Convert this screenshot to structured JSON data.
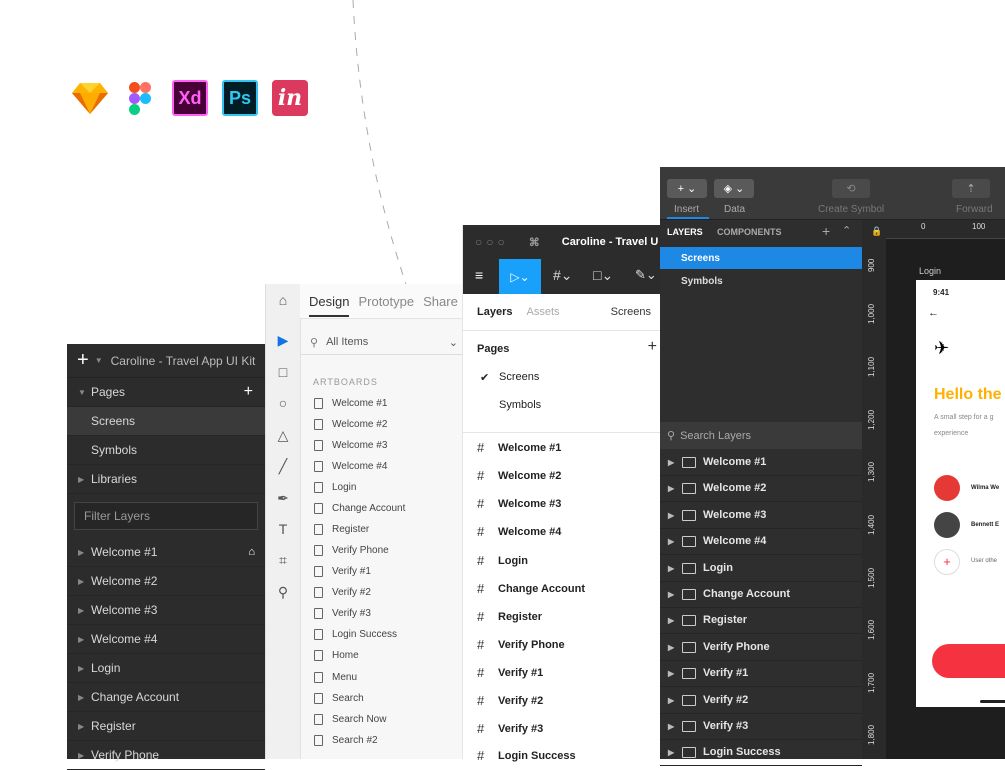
{
  "app_icons": [
    "sketch-icon",
    "figma-icon",
    "Xd",
    "Ps",
    "in"
  ],
  "panel1": {
    "title": "Caroline - Travel App UI Kit",
    "pages_label": "Pages",
    "pages": [
      "Screens",
      "Symbols",
      "Libraries"
    ],
    "filter_placeholder": "Filter Layers",
    "layers": [
      "Welcome #1",
      "Welcome #2",
      "Welcome #3",
      "Welcome #4",
      "Login",
      "Change Account",
      "Register",
      "Verify Phone"
    ]
  },
  "panel2": {
    "tabs": [
      "Design",
      "Prototype",
      "Share"
    ],
    "search": "All Items",
    "section": "ARTBOARDS",
    "items": [
      "Welcome #1",
      "Welcome #2",
      "Welcome #3",
      "Welcome #4",
      "Login",
      "Change Account",
      "Register",
      "Verify Phone",
      "Verify #1",
      "Verify #2",
      "Verify #3",
      "Login Success",
      "Home",
      "Menu",
      "Search",
      "Search Now",
      "Search #2"
    ]
  },
  "panel3": {
    "title": "Caroline - Travel U",
    "tabs": [
      "Layers",
      "Assets"
    ],
    "page_selector": "Screens",
    "pages_label": "Pages",
    "pages": [
      "Screens",
      "Symbols"
    ],
    "frames": [
      "Welcome #1",
      "Welcome #2",
      "Welcome #3",
      "Welcome #4",
      "Login",
      "Change Account",
      "Register",
      "Verify Phone",
      "Verify #1",
      "Verify #2",
      "Verify #3",
      "Login Success"
    ]
  },
  "panel4": {
    "toolbar": {
      "insert": "Insert",
      "data": "Data",
      "create_symbol": "Create Symbol",
      "forward": "Forward"
    },
    "tabs": [
      "LAYERS",
      "COMPONENTS"
    ],
    "pages": [
      "Screens",
      "Symbols"
    ],
    "search_placeholder": "Search Layers",
    "layers": [
      "Welcome #1",
      "Welcome #2",
      "Welcome #3",
      "Welcome #4",
      "Login",
      "Change Account",
      "Register",
      "Verify Phone",
      "Verify #1",
      "Verify #2",
      "Verify #3",
      "Login Success"
    ],
    "ruler_v": [
      "900",
      "1,000",
      "1,100",
      "1,200",
      "1,300",
      "1,400",
      "1,500",
      "1,600",
      "1,700",
      "1,800"
    ],
    "ruler_h": [
      "0",
      "100"
    ],
    "artboard_label": "Login",
    "phone": {
      "time": "9:41",
      "headline": "Hello the",
      "subtext": "A small step for a g",
      "subtext2": "experience",
      "users": [
        "Wilma We",
        "Bennett E"
      ],
      "add_label": "User othe"
    }
  },
  "colors": {
    "accent_blue": "#1e88e5",
    "figma_blue": "#18a0fb",
    "headline": "#ffb000",
    "button_red": "#f5323f"
  }
}
